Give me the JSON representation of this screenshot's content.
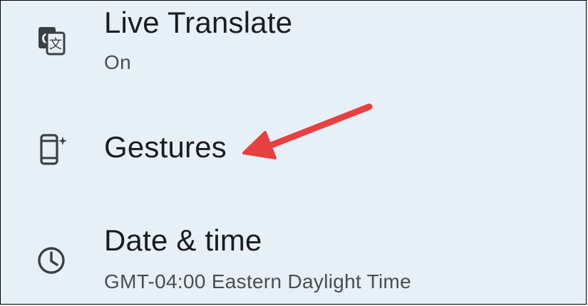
{
  "settings": {
    "items": [
      {
        "title": "Live Translate",
        "subtitle": "On",
        "icon": "translate-icon"
      },
      {
        "title": "Gestures",
        "subtitle": "",
        "icon": "phone-gestures-icon"
      },
      {
        "title": "Date & time",
        "subtitle": "GMT-04:00 Eastern Daylight Time",
        "icon": "clock-icon"
      }
    ]
  },
  "colors": {
    "background": "#e8f0f7",
    "text_primary": "#1b1c1e",
    "text_secondary": "#4a4d52",
    "icon": "#3c4043",
    "annotation_arrow": "#e84040"
  }
}
